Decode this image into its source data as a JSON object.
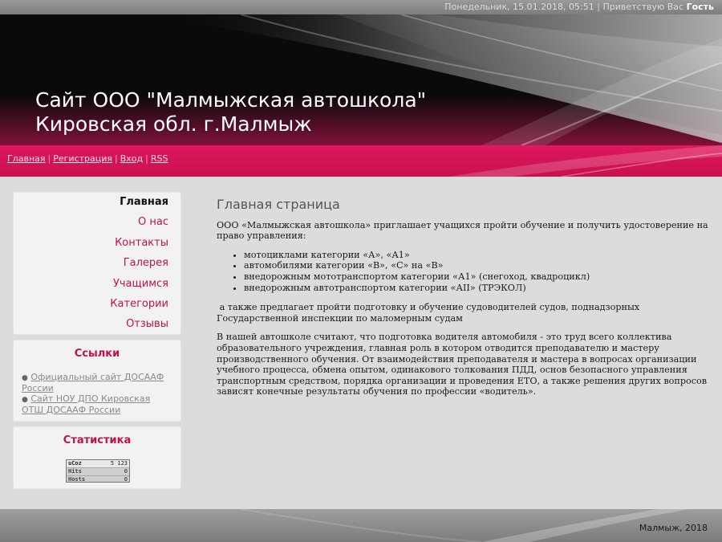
{
  "topbar": {
    "date_time": "Понедельник, 15.01.2018, 05:51",
    "greeting": "Приветствую Вас",
    "user": "Гость"
  },
  "header": {
    "title_line1": "Сайт ООО \"Малмыжская автошкола\"",
    "title_line2": "Кировская обл. г.Малмыж"
  },
  "nav": {
    "home": "Главная",
    "register": "Регистрация",
    "login": "Вход",
    "rss": "RSS"
  },
  "sidebar": {
    "menu": [
      {
        "label": "Главная",
        "active": true
      },
      {
        "label": "О нас"
      },
      {
        "label": "Контакты"
      },
      {
        "label": "Галерея"
      },
      {
        "label": "Учащимся"
      },
      {
        "label": "Категории"
      },
      {
        "label": "Отзывы"
      }
    ],
    "links_title": "Ссылки",
    "links": [
      {
        "label": "Официальный сайт ДОСААФ России"
      },
      {
        "label": "Сайт НОУ ДПО Кировская ОТШ ДОСААФ России"
      }
    ],
    "stats_title": "Статистика",
    "counter": {
      "row1_label": "uCoz",
      "row1_value": "5 123",
      "row2_label": "Hits",
      "row2_value": "0",
      "row3_label": "Hosts",
      "row3_value": "0"
    }
  },
  "main": {
    "title": "Главная страница",
    "intro": "ООО «Малмыжская автошкола» приглашает учащихся пройти обучение и получить удостоверение на право управления:",
    "items": [
      "мотоциклами категории «А», «А1»",
      "автомобилями категории «В», «С» на «В»",
      "внедорожным мототранспортом категории «А1» (снегоход, квадроцикл)",
      "внедорожным автотранспортом категории «АII» (ТРЭКОЛ)"
    ],
    "paragraph2": " а также предлагает пройти подготовку и обучение судоводителей судов, поднадзорных Государственной инспекции по маломерным судам",
    "paragraph3": "В нашей автошколе считают, что подготовка водителя автомобиля - это труд всего коллектива образовательного учреждения, главная роль в котором отводится преподавателю и мастеру производственного обучения. От взаимодействия преподавателя и мастера в вопросах организации учебного процесса, обмена опытом, одинакового толкования ПДД, основ безопасного управления транспортным средством, порядка организации и проведения ЕТО, а также решения других вопросов зависят конечные результаты обучения по профессии «водитель»."
  },
  "footer": {
    "text": "Малмыж, 2018"
  },
  "colors": {
    "accent": "#c2114f",
    "nav_bar": "#d8145a",
    "header_bg": "#0b0b0b"
  }
}
